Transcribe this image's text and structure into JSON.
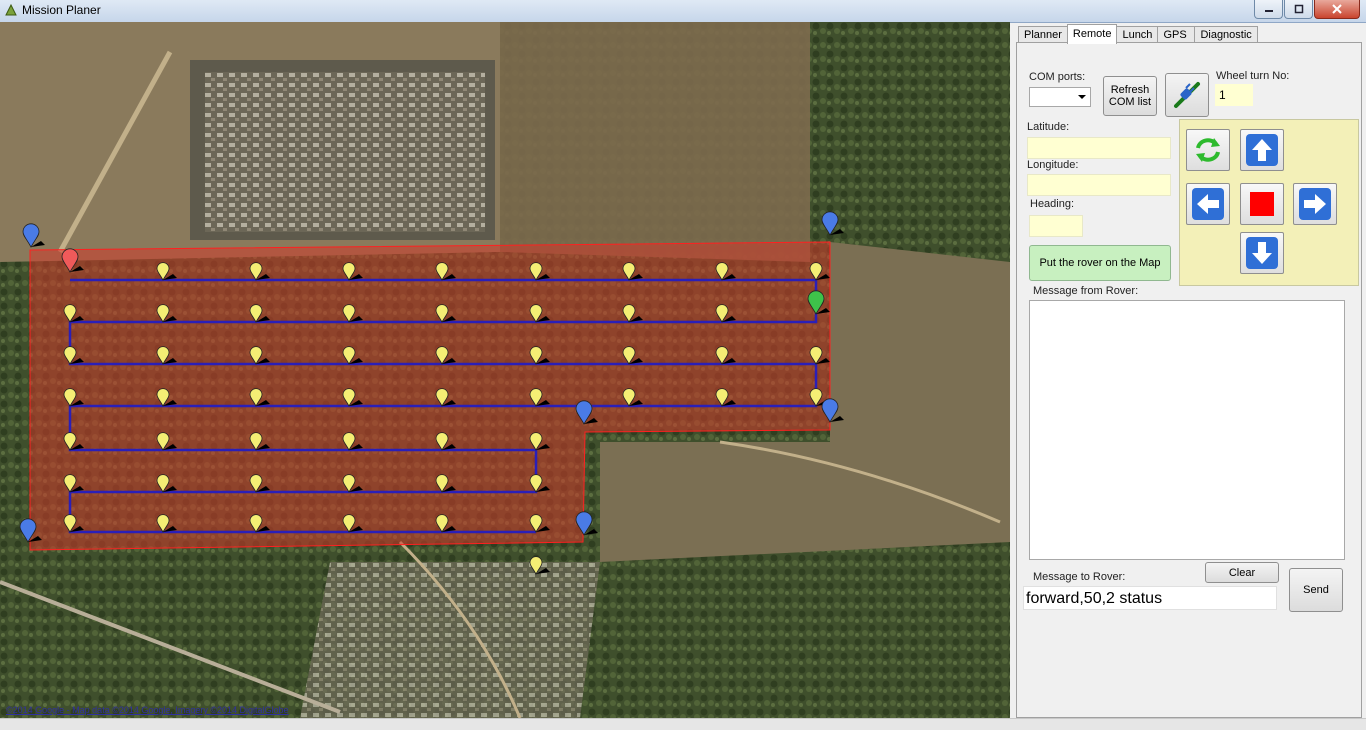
{
  "window": {
    "title": "Mission Planer"
  },
  "tabs": [
    {
      "label": "Planner"
    },
    {
      "label": "Remote"
    },
    {
      "label": "Lunch"
    },
    {
      "label": "GPS"
    },
    {
      "label": "Diagnostic"
    }
  ],
  "active_tab": "Remote",
  "remote": {
    "com_ports_label": "COM ports:",
    "com_ports_value": "",
    "refresh_label": "Refresh\nCOM list",
    "wheel_turn_label": "Wheel turn No:",
    "wheel_turn_value": "1",
    "latitude_label": "Latitude:",
    "latitude_value": "",
    "longitude_label": "Longitude:",
    "longitude_value": "",
    "heading_label": "Heading:",
    "heading_value": "",
    "put_rover_label": "Put the rover on the Map",
    "message_from_label": "Message from Rover:",
    "message_from_value": "",
    "clear_label": "Clear",
    "message_to_label": "Message to Rover:",
    "message_to_value": "forward,50,2 status",
    "send_label": "Send"
  },
  "map": {
    "copyright": "©2014 Google - Map data ©2014 Google, Imagery ©2014 DigitalGlobe",
    "polygon_color": "#d23b2b",
    "path_color": "#2a1fb8",
    "waypoint_color": "#f4ee74",
    "corner_marker_color": "#4a7be6",
    "start_marker_color": "#ef5a5a",
    "rover_marker_color": "#3ec24a"
  },
  "colors": {
    "arrow_pad_bg": "#f3f0b8",
    "field_bg": "#ffffd2",
    "put_rover_bg": "#c8f0c0",
    "arrow_icon_blue": "#2f6fd6",
    "stop_red": "#ff0000"
  },
  "icons": [
    "connect-plug-icon",
    "refresh-cycle-icon",
    "arrow-up-icon",
    "arrow-left-icon",
    "stop-icon",
    "arrow-right-icon",
    "arrow-down-icon"
  ]
}
